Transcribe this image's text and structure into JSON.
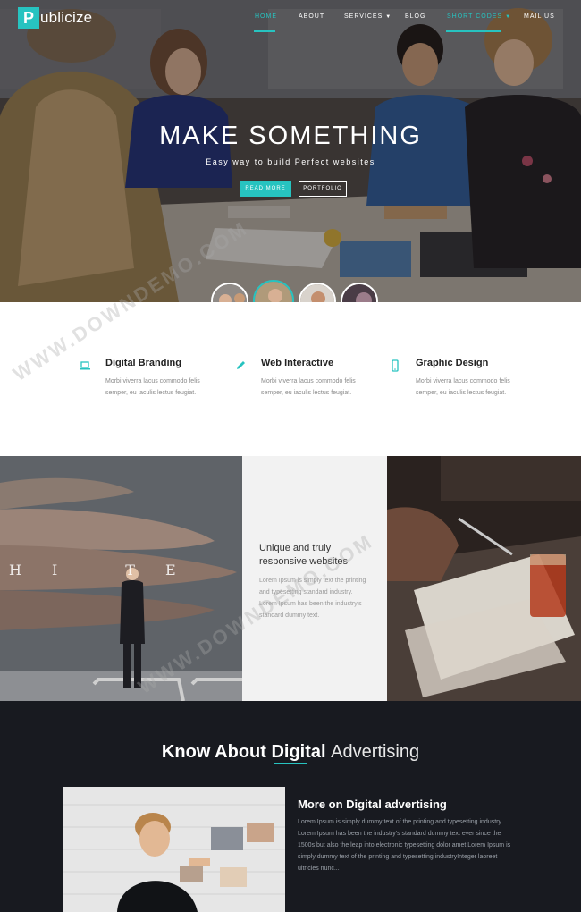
{
  "brand": {
    "logo_letter": "P",
    "logo_rest": "ublicize"
  },
  "nav": [
    {
      "label": "HOME",
      "active": true
    },
    {
      "label": "ABOUT",
      "active": false
    },
    {
      "label": "SERVICES",
      "active": false,
      "dropdown": true
    },
    {
      "label": "BLOG",
      "active": false
    },
    {
      "label": "SHORT CODES",
      "active": true,
      "dropdown": true
    },
    {
      "label": "MAIL US",
      "active": false
    }
  ],
  "hero": {
    "title": "MAKE SOMETHING",
    "subtitle": "Easy way to build Perfect websites",
    "btn_primary": "READ MORE",
    "btn_secondary": "PORTFOLIO",
    "active_slide": 2,
    "slides_count": 4
  },
  "features": [
    {
      "icon": "laptop-icon",
      "title": "Digital Branding",
      "text": "Morbi viverra lacus commodo felis semper, eu iaculis lectus feugiat."
    },
    {
      "icon": "pencil-icon",
      "title": "Web Interactive",
      "text": "Morbi viverra lacus commodo felis semper, eu iaculis lectus feugiat."
    },
    {
      "icon": "mobile-icon",
      "title": "Graphic Design",
      "text": "Morbi viverra lacus commodo felis semper, eu iaculis lectus feugiat."
    }
  ],
  "row3": {
    "left_overlay": "HI_TE",
    "mid_title": "Unique and truly responsive websites",
    "mid_text": "Lorem Ipsum is simply text the printing and typesetting standard industry. Lorem Ipsum has been the industry's standard dummy text."
  },
  "about": {
    "title_bold": "Know About Digital",
    "title_light": "Advertising",
    "heading": "More on Digital advertising",
    "text": "Lorem Ipsum is simply dummy text of the printing and typesetting industry. Lorem Ipsum has been the industry's standard dummy text ever since the 1500s but also the leap into electronic typesetting dolor amet.Lorem Ipsum is simply dummy text of the printing and typesetting industryInteger laoreet ultricies nunc..."
  },
  "watermark": "WWW.DOWNDEMO.COM",
  "colors": {
    "accent": "#27c3c0",
    "dark_bg": "#181a20",
    "mid_panel_bg": "#f2f2f2"
  }
}
